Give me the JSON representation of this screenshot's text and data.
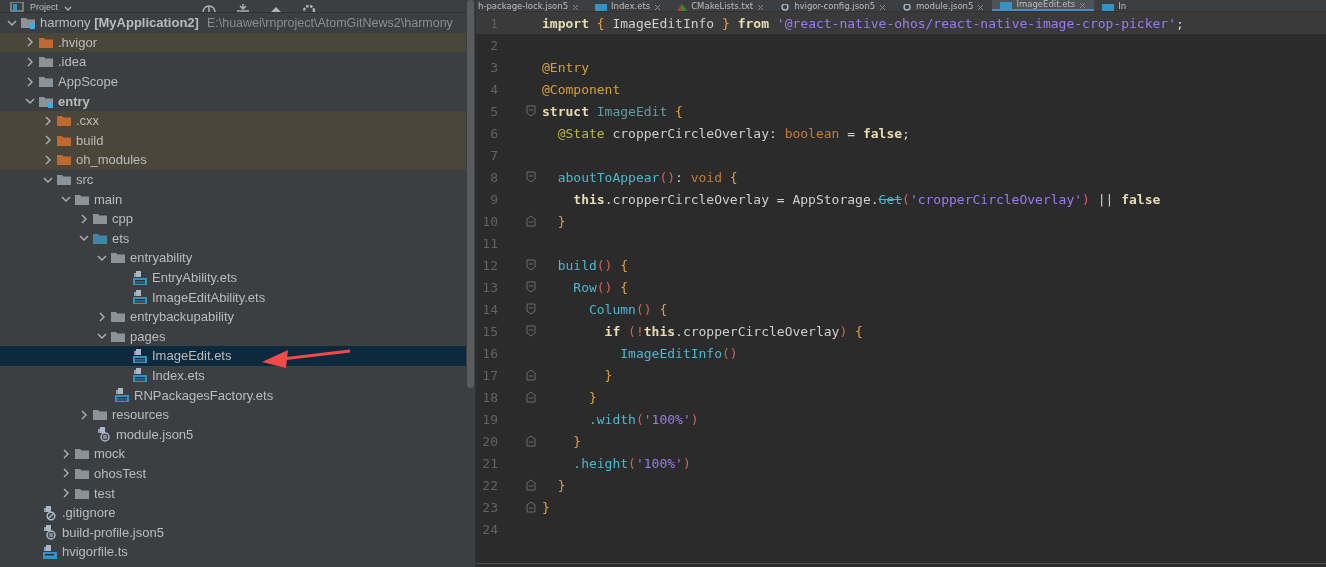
{
  "project": {
    "title": "Project",
    "tree": {
      "label": "harmony **[MyApplication2]**",
      "path": "E:\\huawei\\rnproject\\AtomGitNews2\\harmony",
      "kind": "module",
      "expanded": true,
      "selected": false,
      "children": [
        {
          "label": ".hvigor",
          "kind": "folder-excluded",
          "expanded": false,
          "selected": false
        },
        {
          "label": ".idea",
          "kind": "folder",
          "expanded": false,
          "selected": false
        },
        {
          "label": "AppScope",
          "kind": "folder",
          "expanded": false,
          "selected": false
        },
        {
          "label": "entry",
          "kind": "module",
          "expanded": true,
          "selected": false,
          "children": [
            {
              "label": ".cxx",
              "kind": "folder-excluded",
              "expanded": false,
              "selected": false
            },
            {
              "label": "build",
              "kind": "folder-excluded",
              "expanded": false,
              "selected": false
            },
            {
              "label": "oh_modules",
              "kind": "folder-excluded",
              "expanded": false,
              "selected": false
            },
            {
              "label": "src",
              "kind": "folder",
              "expanded": true,
              "selected": false,
              "children": [
                {
                  "label": "main",
                  "kind": "folder",
                  "expanded": true,
                  "selected": false,
                  "children": [
                    {
                      "label": "cpp",
                      "kind": "folder",
                      "expanded": false,
                      "selected": false
                    },
                    {
                      "label": "ets",
                      "kind": "folder-source",
                      "expanded": true,
                      "selected": false,
                      "children": [
                        {
                          "label": "entryability",
                          "kind": "folder",
                          "expanded": true,
                          "selected": false,
                          "children": [
                            {
                              "label": "EntryAbility.ets",
                              "kind": "file-ets",
                              "selected": false
                            },
                            {
                              "label": "ImageEditAbility.ets",
                              "kind": "file-ets",
                              "selected": false
                            }
                          ]
                        },
                        {
                          "label": "entrybackupability",
                          "kind": "folder",
                          "expanded": false,
                          "selected": false
                        },
                        {
                          "label": "pages",
                          "kind": "folder",
                          "expanded": true,
                          "selected": false,
                          "children": [
                            {
                              "label": "ImageEdit.ets",
                              "kind": "file-ets",
                              "selected": true
                            },
                            {
                              "label": "Index.ets",
                              "kind": "file-ets",
                              "selected": false
                            }
                          ]
                        },
                        {
                          "label": "RNPackagesFactory.ets",
                          "kind": "file-ets",
                          "selected": false
                        }
                      ]
                    },
                    {
                      "label": "resources",
                      "kind": "folder",
                      "expanded": false,
                      "selected": false
                    },
                    {
                      "label": "module.json5",
                      "kind": "file-json",
                      "selected": false
                    }
                  ]
                },
                {
                  "label": "mock",
                  "kind": "folder",
                  "expanded": false,
                  "selected": false
                },
                {
                  "label": "ohosTest",
                  "kind": "folder",
                  "expanded": false,
                  "selected": false
                },
                {
                  "label": "test",
                  "kind": "folder",
                  "expanded": false,
                  "selected": false
                }
              ]
            }
          ]
        },
        {
          "label": ".gitignore",
          "kind": "file-ignore",
          "selected": false
        },
        {
          "label": "build-profile.json5",
          "kind": "file-json",
          "selected": false
        },
        {
          "label": "hvigorfile.ts",
          "kind": "file-ts",
          "selected": false
        }
      ]
    }
  },
  "editor": {
    "tabs": [
      {
        "label": "h-package-lock.json5",
        "kind": "none",
        "selected": false
      },
      {
        "label": "Index.ets",
        "kind": "ets",
        "selected": false
      },
      {
        "label": "CMakeLists.txt",
        "kind": "cmake",
        "selected": false
      },
      {
        "label": "hvigor-config.json5",
        "kind": "json",
        "selected": false
      },
      {
        "label": "module.json5",
        "kind": "json",
        "selected": false
      },
      {
        "label": "ImageEdit.ets",
        "kind": "ets",
        "selected": true
      },
      {
        "label": "In",
        "kind": "ets",
        "selected": false
      }
    ],
    "lines": [
      {
        "number": "1",
        "kind": "plain",
        "current": true,
        "tokens": [
          {
            "kind": "keyword",
            "text": "import "
          },
          {
            "kind": "brace",
            "text": "{"
          },
          {
            "kind": "plain",
            "text": " ImageEditInfo "
          },
          {
            "kind": "brace",
            "text": "}"
          },
          {
            "kind": "keyword",
            "text": " from "
          },
          {
            "kind": "string",
            "text": "'@react-native-ohos/react-native-image-crop-picker'"
          },
          {
            "kind": "plain",
            "text": ";"
          }
        ]
      },
      {
        "number": "2",
        "kind": "plain",
        "current": false
      },
      {
        "number": "3",
        "kind": "plain",
        "current": false,
        "tokens": [
          {
            "kind": "decorator",
            "text": "@Entry"
          }
        ]
      },
      {
        "number": "4",
        "kind": "plain",
        "current": false,
        "tokens": [
          {
            "kind": "decorator",
            "text": "@Component"
          }
        ]
      },
      {
        "number": "5",
        "kind": "block-start",
        "current": false,
        "tokens": [
          {
            "kind": "keyword",
            "text": "struct "
          },
          {
            "kind": "type",
            "text": "ImageEdit "
          },
          {
            "kind": "brace",
            "text": "{"
          }
        ]
      },
      {
        "number": "6",
        "kind": "plain",
        "current": false,
        "tokens": [
          {
            "kind": "annotation",
            "text": "  @State"
          },
          {
            "kind": "plain",
            "text": " cropperCircleOverlay: "
          },
          {
            "kind": "builtin",
            "text": "boolean"
          },
          {
            "kind": "plain",
            "text": " = "
          },
          {
            "kind": "keyword",
            "text": "false"
          },
          {
            "kind": "plain",
            "text": ";"
          }
        ]
      },
      {
        "number": "7",
        "kind": "plain",
        "current": false
      },
      {
        "number": "8",
        "kind": "block-start",
        "current": false,
        "tokens": [
          {
            "kind": "function",
            "text": "  aboutToAppear"
          },
          {
            "kind": "paren",
            "text": "()"
          },
          {
            "kind": "plain",
            "text": ": "
          },
          {
            "kind": "builtin",
            "text": "void "
          },
          {
            "kind": "brace",
            "text": "{"
          }
        ]
      },
      {
        "number": "9",
        "kind": "plain",
        "current": false,
        "tokens": [
          {
            "kind": "keyword",
            "text": "    this"
          },
          {
            "kind": "plain",
            "text": ".cropperCircleOverlay = AppStorage."
          },
          {
            "kind": "deprecated",
            "text": "Get"
          },
          {
            "kind": "paren",
            "text": "("
          },
          {
            "kind": "string",
            "text": "'cropperCircleOverlay'"
          },
          {
            "kind": "paren",
            "text": ")"
          },
          {
            "kind": "plain",
            "text": " || "
          },
          {
            "kind": "keyword",
            "text": "false"
          }
        ]
      },
      {
        "number": "10",
        "kind": "block-end",
        "current": false,
        "tokens": [
          {
            "kind": "brace",
            "text": "  }"
          }
        ]
      },
      {
        "number": "11",
        "kind": "plain",
        "current": false
      },
      {
        "number": "12",
        "kind": "block-start",
        "current": false,
        "tokens": [
          {
            "kind": "function",
            "text": "  build"
          },
          {
            "kind": "paren",
            "text": "() "
          },
          {
            "kind": "brace",
            "text": "{"
          }
        ]
      },
      {
        "number": "13",
        "kind": "block-start",
        "current": false,
        "tokens": [
          {
            "kind": "function",
            "text": "    Row"
          },
          {
            "kind": "paren",
            "text": "() "
          },
          {
            "kind": "brace",
            "text": "{"
          }
        ]
      },
      {
        "number": "14",
        "kind": "block-start",
        "current": false,
        "tokens": [
          {
            "kind": "function",
            "text": "      Column"
          },
          {
            "kind": "paren",
            "text": "() "
          },
          {
            "kind": "brace",
            "text": "{"
          }
        ]
      },
      {
        "number": "15",
        "kind": "block-start",
        "current": false,
        "tokens": [
          {
            "kind": "keyword",
            "text": "        if "
          },
          {
            "kind": "paren",
            "text": "(!"
          },
          {
            "kind": "keyword",
            "text": "this"
          },
          {
            "kind": "plain",
            "text": ".cropperCircleOverlay"
          },
          {
            "kind": "paren",
            "text": ") "
          },
          {
            "kind": "brace",
            "text": "{"
          }
        ]
      },
      {
        "number": "16",
        "kind": "plain",
        "current": false,
        "tokens": [
          {
            "kind": "function",
            "text": "          ImageEditInfo"
          },
          {
            "kind": "paren",
            "text": "()"
          }
        ]
      },
      {
        "number": "17",
        "kind": "block-end",
        "current": false,
        "tokens": [
          {
            "kind": "brace",
            "text": "        }"
          }
        ]
      },
      {
        "number": "18",
        "kind": "block-end",
        "current": false,
        "tokens": [
          {
            "kind": "brace",
            "text": "      }"
          }
        ]
      },
      {
        "number": "19",
        "kind": "plain",
        "current": false,
        "tokens": [
          {
            "kind": "function",
            "text": "      .width"
          },
          {
            "kind": "paren",
            "text": "("
          },
          {
            "kind": "string",
            "text": "'100%'"
          },
          {
            "kind": "paren",
            "text": ")"
          }
        ]
      },
      {
        "number": "20",
        "kind": "block-end",
        "current": false,
        "tokens": [
          {
            "kind": "brace",
            "text": "    }"
          }
        ]
      },
      {
        "number": "21",
        "kind": "plain",
        "current": false,
        "tokens": [
          {
            "kind": "function",
            "text": "    .height"
          },
          {
            "kind": "paren",
            "text": "("
          },
          {
            "kind": "string",
            "text": "'100%'"
          },
          {
            "kind": "paren",
            "text": ")"
          }
        ]
      },
      {
        "number": "22",
        "kind": "block-end",
        "current": false,
        "tokens": [
          {
            "kind": "brace",
            "text": "  }"
          }
        ]
      },
      {
        "number": "23",
        "kind": "block-end",
        "current": false,
        "tokens": [
          {
            "kind": "brace",
            "text": "}"
          }
        ]
      },
      {
        "number": "24",
        "kind": "plain",
        "current": false
      }
    ]
  }
}
